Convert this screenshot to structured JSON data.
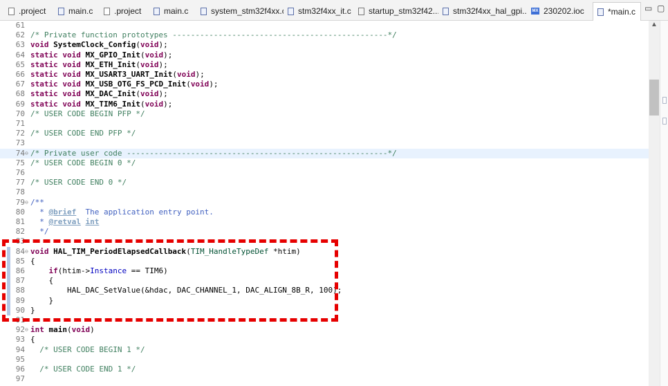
{
  "tabs": [
    {
      "label": ".project",
      "icon": "file"
    },
    {
      "label": "main.c",
      "icon": "c"
    },
    {
      "label": ".project",
      "icon": "file"
    },
    {
      "label": "main.c",
      "icon": "c"
    },
    {
      "label": "system_stm32f4xx.c",
      "icon": "c"
    },
    {
      "label": "stm32f4xx_it.c",
      "icon": "c"
    },
    {
      "label": "startup_stm32f42...",
      "icon": "s"
    },
    {
      "label": "stm32f4xx_hal_gpi...",
      "icon": "c"
    },
    {
      "label": "230202.ioc",
      "icon": "mx"
    },
    {
      "label": "*main.c",
      "icon": "c",
      "active": true
    }
  ],
  "window": {
    "minimize": "▭",
    "maximize": "▢",
    "mx_badge": "MX"
  },
  "lines": [
    {
      "n": "61",
      "t": []
    },
    {
      "n": "62",
      "t": [
        [
          "cm",
          "/* Private function prototypes -----------------------------------------------*/"
        ]
      ]
    },
    {
      "n": "63",
      "t": [
        [
          "kw",
          "void"
        ],
        [
          "",
          " "
        ],
        [
          "fn",
          "SystemClock_Config"
        ],
        [
          "",
          "("
        ],
        [
          "kw",
          "void"
        ],
        [
          "",
          ");"
        ]
      ]
    },
    {
      "n": "64",
      "t": [
        [
          "kw",
          "static void"
        ],
        [
          "",
          " "
        ],
        [
          "fn",
          "MX_GPIO_Init"
        ],
        [
          "",
          "("
        ],
        [
          "kw",
          "void"
        ],
        [
          "",
          ");"
        ]
      ]
    },
    {
      "n": "65",
      "t": [
        [
          "kw",
          "static void"
        ],
        [
          "",
          " "
        ],
        [
          "fn",
          "MX_ETH_Init"
        ],
        [
          "",
          "("
        ],
        [
          "kw",
          "void"
        ],
        [
          "",
          ");"
        ]
      ]
    },
    {
      "n": "66",
      "t": [
        [
          "kw",
          "static void"
        ],
        [
          "",
          " "
        ],
        [
          "fn",
          "MX_USART3_UART_Init"
        ],
        [
          "",
          "("
        ],
        [
          "kw",
          "void"
        ],
        [
          "",
          ");"
        ]
      ]
    },
    {
      "n": "67",
      "t": [
        [
          "kw",
          "static void"
        ],
        [
          "",
          " "
        ],
        [
          "fn",
          "MX_USB_OTG_FS_PCD_Init"
        ],
        [
          "",
          "("
        ],
        [
          "kw",
          "void"
        ],
        [
          "",
          ");"
        ]
      ]
    },
    {
      "n": "68",
      "t": [
        [
          "kw",
          "static void"
        ],
        [
          "",
          " "
        ],
        [
          "fn",
          "MX_DAC_Init"
        ],
        [
          "",
          "("
        ],
        [
          "kw",
          "void"
        ],
        [
          "",
          ");"
        ]
      ]
    },
    {
      "n": "69",
      "t": [
        [
          "kw",
          "static void"
        ],
        [
          "",
          " "
        ],
        [
          "fn",
          "MX_TIM6_Init"
        ],
        [
          "",
          "("
        ],
        [
          "kw",
          "void"
        ],
        [
          "",
          ");"
        ]
      ]
    },
    {
      "n": "70",
      "t": [
        [
          "cm",
          "/* USER CODE BEGIN PFP */"
        ]
      ]
    },
    {
      "n": "71",
      "t": []
    },
    {
      "n": "72",
      "t": [
        [
          "cm",
          "/* USER CODE END PFP */"
        ]
      ]
    },
    {
      "n": "73",
      "t": []
    },
    {
      "n": "74",
      "fold": "⊖",
      "hl": true,
      "t": [
        [
          "cm",
          "/* Private user code ---------------------------------------------------------*/"
        ]
      ]
    },
    {
      "n": "75",
      "t": [
        [
          "cm",
          "/* USER CODE BEGIN 0 */"
        ]
      ]
    },
    {
      "n": "76",
      "t": []
    },
    {
      "n": "77",
      "t": [
        [
          "cm",
          "/* USER CODE END 0 */"
        ]
      ]
    },
    {
      "n": "78",
      "t": []
    },
    {
      "n": "79",
      "fold": "⊖",
      "t": [
        [
          "doctxt",
          "/**"
        ]
      ]
    },
    {
      "n": "80",
      "t": [
        [
          "doctxt",
          "  * "
        ],
        [
          "doctag",
          "@brief"
        ],
        [
          "doctxt",
          "  The application entry point."
        ]
      ]
    },
    {
      "n": "81",
      "t": [
        [
          "doctxt",
          "  * "
        ],
        [
          "doctag",
          "@retval"
        ],
        [
          "doctxt",
          " "
        ],
        [
          "doctag",
          "int"
        ]
      ]
    },
    {
      "n": "82",
      "t": [
        [
          "doctxt",
          "  */"
        ]
      ]
    },
    {
      "n": "83",
      "t": []
    },
    {
      "n": "84",
      "fold": "⊖",
      "mark": true,
      "t": [
        [
          "kw",
          "void"
        ],
        [
          "",
          " "
        ],
        [
          "fn",
          "HAL_TIM_PeriodElapsedCallback"
        ],
        [
          "",
          "("
        ],
        [
          "ty",
          "TIM_HandleTypeDef"
        ],
        [
          "",
          " *htim)"
        ]
      ]
    },
    {
      "n": "85",
      "mark": true,
      "t": [
        [
          "",
          "{"
        ]
      ]
    },
    {
      "n": "86",
      "mark": true,
      "t": [
        [
          "",
          "    "
        ],
        [
          "kw",
          "if"
        ],
        [
          "",
          "(htim->"
        ],
        [
          "fld",
          "Instance"
        ],
        [
          "",
          " == TIM6)"
        ]
      ]
    },
    {
      "n": "87",
      "mark": true,
      "t": [
        [
          "",
          "    {"
        ]
      ]
    },
    {
      "n": "88",
      "mark": true,
      "t": [
        [
          "",
          "        HAL_DAC_SetValue(&hdac, DAC_CHANNEL_1, DAC_ALIGN_8B_R, 100);"
        ]
      ]
    },
    {
      "n": "89",
      "mark": true,
      "t": [
        [
          "",
          "    }"
        ]
      ]
    },
    {
      "n": "90",
      "mark": true,
      "t": [
        [
          "",
          "}"
        ]
      ]
    },
    {
      "n": "91",
      "t": []
    },
    {
      "n": "92",
      "fold": "⊖",
      "t": [
        [
          "kw",
          "int"
        ],
        [
          "",
          " "
        ],
        [
          "fn",
          "main"
        ],
        [
          "",
          "("
        ],
        [
          "kw",
          "void"
        ],
        [
          "",
          ")"
        ]
      ]
    },
    {
      "n": "93",
      "t": [
        [
          "",
          "{"
        ]
      ]
    },
    {
      "n": "94",
      "t": [
        [
          "",
          "  "
        ],
        [
          "cm",
          "/* USER CODE BEGIN 1 */"
        ]
      ]
    },
    {
      "n": "95",
      "t": []
    },
    {
      "n": "96",
      "t": [
        [
          "",
          "  "
        ],
        [
          "cm",
          "/* USER CODE END 1 */"
        ]
      ]
    },
    {
      "n": "97",
      "t": []
    }
  ]
}
